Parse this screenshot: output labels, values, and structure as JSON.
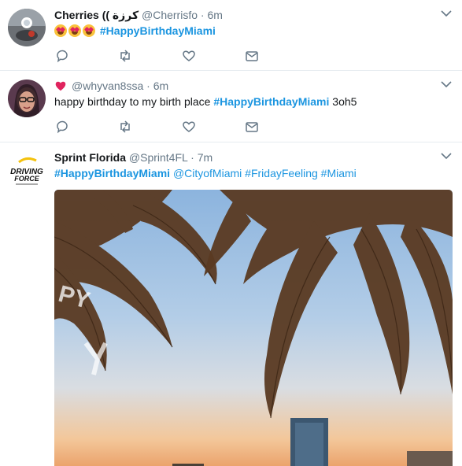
{
  "tweets": [
    {
      "name": "Cherries ((",
      "name_rtl": "كرزة",
      "handle": "@Cherrisfo",
      "separator": "·",
      "time": "6m",
      "hashtag": "#HappyBirthdayMiami",
      "emoji_count": 3
    },
    {
      "handle": "@whyvan8ssa",
      "separator": "·",
      "time": "6m",
      "text_before": "happy birthday to my birth place ",
      "hashtag": "#HappyBirthdayMiami",
      "text_after": " 3oh5"
    },
    {
      "name": "Sprint Florida",
      "handle": "@Sprint4FL",
      "separator": "·",
      "time": "7m",
      "hashtag": "#HappyBirthdayMiami",
      "mention": "@CityofMiami",
      "tag2": "#FridayFeeling",
      "tag3": "#Miami",
      "logo_line1": "DRIVING",
      "logo_line2": "FORCE",
      "media_text": "PY"
    }
  ],
  "icons": {
    "reply": "reply-icon",
    "retweet": "retweet-icon",
    "like": "heart-icon",
    "dm": "envelope-icon",
    "caret": "chevron-down-icon"
  },
  "colors": {
    "link": "#1b95e0",
    "muted": "#657786",
    "text": "#14171a",
    "heart": "#e0245e"
  }
}
